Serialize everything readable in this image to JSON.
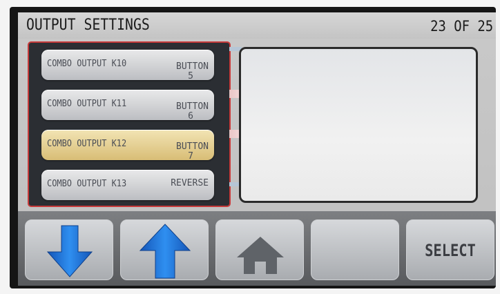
{
  "header": {
    "title": "OUTPUT SETTINGS",
    "page_indicator": "23 OF 25"
  },
  "list": {
    "items": [
      {
        "label": "COMBO OUTPUT K10",
        "value_line1": "BUTTON",
        "value_line2": "5",
        "selected": false
      },
      {
        "label": "COMBO OUTPUT K11",
        "value_line1": "BUTTON",
        "value_line2": "6",
        "selected": false
      },
      {
        "label": "COMBO OUTPUT K12",
        "value_line1": "BUTTON",
        "value_line2": "7",
        "selected": true
      },
      {
        "label": "COMBO OUTPUT K13",
        "value_line1": "REVERSE",
        "value_line2": "",
        "selected": false
      }
    ]
  },
  "toolbar": {
    "buttons": [
      {
        "icon": "arrow-down-icon",
        "label": ""
      },
      {
        "icon": "arrow-up-icon",
        "label": ""
      },
      {
        "icon": "home-icon",
        "label": ""
      },
      {
        "icon": "",
        "label": ""
      },
      {
        "icon": "",
        "label": "SELECT"
      }
    ]
  },
  "colors": {
    "panel_border": "#c73a3a",
    "selected_row": "#e6cf8f",
    "arrow_blue": "#1a6fd6",
    "home_grey": "#5f6368"
  }
}
